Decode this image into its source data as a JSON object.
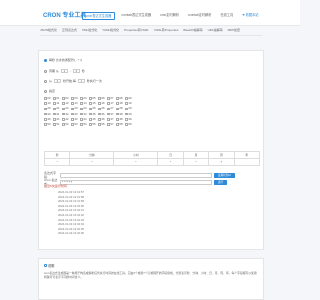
{
  "header": {
    "logo": "CRON 专业工具",
    "tabs": [
      {
        "label": "cron表达式生成器",
        "active": true
      },
      {
        "label": "crontab表达式生成器",
        "active": false
      },
      {
        "label": "cron定时解析",
        "active": false
      },
      {
        "label": "crontab定时解析",
        "active": false
      },
      {
        "label": "在线工具",
        "active": false
      },
      {
        "label": "❤ 收藏本站",
        "active": false
      }
    ]
  },
  "subnav": [
    "JSON格式化",
    "正则表达式",
    "XML格式化",
    "YAML格式化",
    "Properties转YAML",
    "YAML转Properties",
    "Base64编解码",
    "URL编解码",
    "MD5加密"
  ],
  "options": {
    "every_label": "每秒 允许的通配符[, - * /]",
    "cycle_label": "周期 从",
    "cycle_from": "1",
    "cycle_to_text": "-",
    "cycle_to": "2",
    "cycle_unit": "秒",
    "start_label": "从",
    "start_from": "0",
    "start_mid": "秒开始,每",
    "start_every": "1",
    "start_end": "秒执行一次",
    "specify_label": "指定"
  },
  "checkboxes": [
    "00",
    "01",
    "02",
    "03",
    "04",
    "05",
    "06",
    "07",
    "08",
    "09",
    "10",
    "11",
    "12",
    "13",
    "14",
    "15",
    "16",
    "17",
    "18",
    "19",
    "20",
    "21",
    "22",
    "23",
    "24",
    "25",
    "26",
    "27",
    "28",
    "29",
    "30",
    "31",
    "32",
    "33",
    "34",
    "35",
    "36",
    "37",
    "38",
    "39",
    "40",
    "41",
    "42",
    "43",
    "44",
    "45",
    "46",
    "47",
    "48",
    "49",
    "50",
    "51",
    "52",
    "53",
    "54",
    "55",
    "56",
    "57",
    "58",
    "59"
  ],
  "fields": {
    "headers": [
      "秒",
      "分钟",
      "小时",
      "日",
      "月",
      "周",
      "年"
    ],
    "values": [
      "*",
      "*",
      "*",
      "*",
      "*",
      "?",
      ""
    ]
  },
  "expression": {
    "field_label": "表达式字段:",
    "cron_label": "Cron 表达式:",
    "cron_value": "* * * * * ?",
    "reverse_button": "反解析到UI",
    "run_button": "运行"
  },
  "runs": {
    "title": "最近5次运行时间:",
    "items": [
      "2024-01-03 13:31:57",
      "2024-01-03 13:31:58",
      "2024-01-03 13:31:59",
      "2024-01-03 13:32:00",
      "2024-01-03 13:32:01",
      "2024-01-03 13:32:02",
      "2024-01-03 13:32:03",
      "2024-01-03 13:32:04",
      "2024-01-03 13:32:05",
      "2024-01-03 13:32:06"
    ]
  },
  "explain": {
    "title": "说明",
    "text": "cron表达式生成器是一种用于构造或解析任务执行时间的在线工具。它由6个或者7个空格隔开的字段组成，分别表示秒、分钟、小时、日、月、周、年。每个字段都可以使用特殊符号表示不同的时间含义。"
  }
}
